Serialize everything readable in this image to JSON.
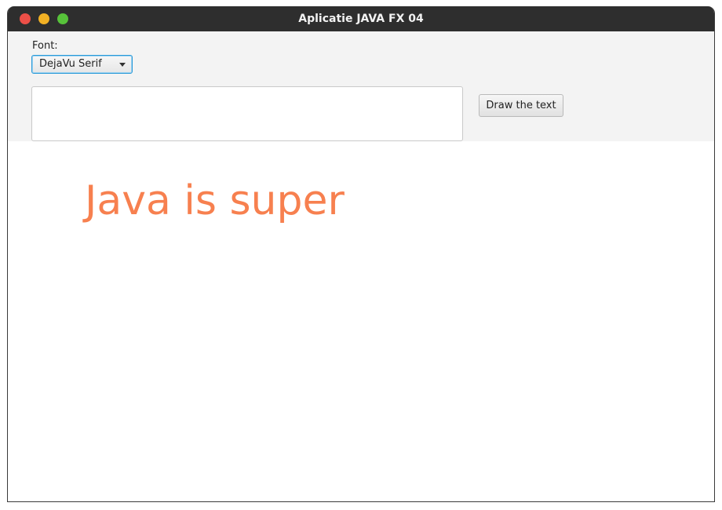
{
  "window": {
    "title": "Aplicatie JAVA FX 04",
    "controls": [
      {
        "name": "close-button",
        "color": "#ec4f47"
      },
      {
        "name": "minimize-button",
        "color": "#f2b124"
      },
      {
        "name": "maximize-button",
        "color": "#57c23a"
      }
    ]
  },
  "toolbar": {
    "font_label": "Font:",
    "font_select_value": "DejaVu Serif",
    "text_area_value": "",
    "draw_button_label": "Draw the text"
  },
  "canvas": {
    "text": "Java is super",
    "text_color": "#f7804f"
  }
}
